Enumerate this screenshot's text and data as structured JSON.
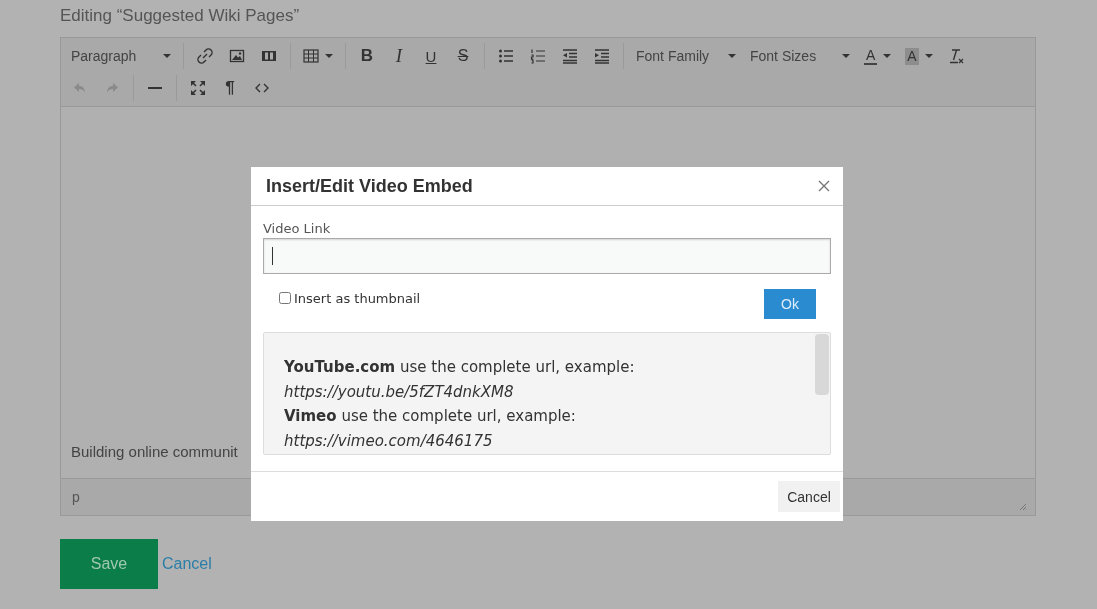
{
  "page": {
    "title": "Editing “Suggested Wiki Pages”"
  },
  "editor": {
    "toolbar": {
      "block_format": "Paragraph",
      "format_buttons": [
        {
          "label": "B",
          "kind": "bold"
        },
        {
          "label": "I",
          "kind": "italic"
        },
        {
          "label": "U",
          "kind": "underline"
        },
        {
          "label": "S",
          "kind": "strike"
        }
      ],
      "font_family": "Font Family",
      "font_sizes": "Font Sizes",
      "text_color_label": "A",
      "background_color_label": "A",
      "undo": {
        "disabled": true
      },
      "redo": {
        "disabled": true
      },
      "paragraph_mark": "¶"
    },
    "content": "Building online communit",
    "status_path": "p"
  },
  "actions": {
    "save": "Save",
    "cancel": "Cancel"
  },
  "dialog": {
    "title": "Insert/Edit Video Embed",
    "field_label": "Video Link",
    "thumbnail_checkbox": {
      "label": "Insert as thumbnail",
      "checked": false
    },
    "ok": "Ok",
    "help_lines": [
      "**YouTube.com** use the complete url, example:",
      "*https://youtu.be/5fZT4dnkXM8*",
      "**Vimeo** use the complete url, example:",
      "*https://vimeo.com/4646175*"
    ],
    "cancel": "Cancel"
  }
}
